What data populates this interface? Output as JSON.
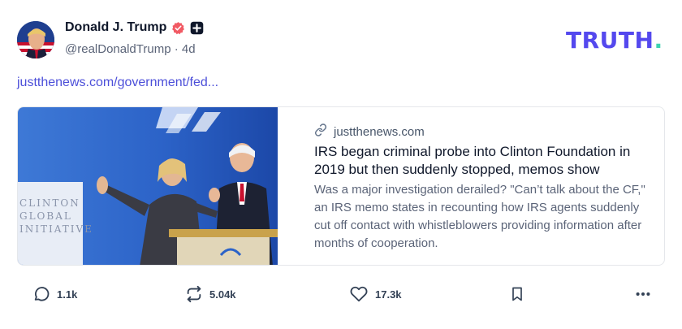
{
  "author": {
    "display_name": "Donald J. Trump",
    "handle": "@realDonaldTrump",
    "separator": "·",
    "age": "4d"
  },
  "brand": {
    "text": "TRUTH",
    "dot": ".",
    "color": "#5448ee",
    "dot_color": "#3fd3b0"
  },
  "post": {
    "link_text": "justthenews.com/government/fed..."
  },
  "card": {
    "domain": "justthenews.com",
    "title": "IRS began criminal probe into Clinton Foundation in 2019 but then suddenly stopped, memos show",
    "description": "Was a major investigation derailed? \"Can’t talk about the CF,\" an IRS memo states in recounting how IRS agents suddenly cut off contact with whistleblowers providing information after months of cooperation.",
    "image_backdrop_text": [
      "CLINTON",
      "GLOBAL",
      "INITIATIVE"
    ]
  },
  "actions": {
    "reply_count": "1.1k",
    "retruth_count": "5.04k",
    "like_count": "17.3k"
  },
  "icons": {
    "verified": "verified-badge-icon",
    "plus": "plus-badge-icon",
    "link": "link-icon",
    "reply": "reply-icon",
    "retruth": "retruth-icon",
    "like": "heart-icon",
    "bookmark": "bookmark-icon",
    "more": "more-icon"
  }
}
